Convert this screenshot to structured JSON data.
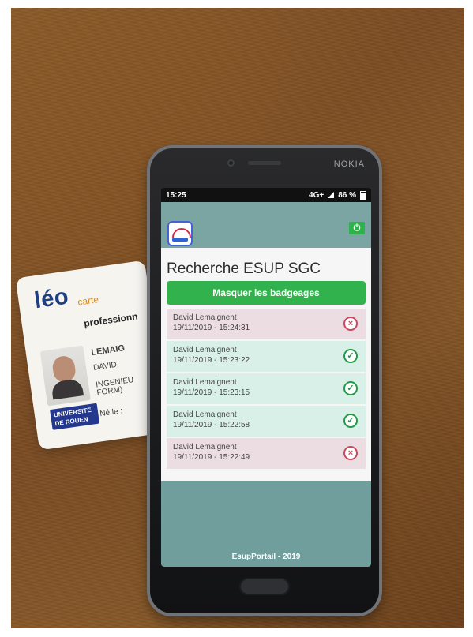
{
  "card": {
    "logo": "léo",
    "subtitle": "carte",
    "heading": "professionn",
    "line1": "LEMAIG",
    "line2": "DAVID",
    "line3": "INGENIEU",
    "line4": "FORM)",
    "line5": "Né le :",
    "univ_line1": "UNIVERSITÉ",
    "univ_line2": "DE ROUEN"
  },
  "phone": {
    "brand": "NOKIA",
    "status": {
      "time": "15:25",
      "network": "4G+",
      "battery": "86 %"
    },
    "app": {
      "title": "Recherche ESUP SGC",
      "hide_button": "Masquer les badgeages",
      "footer": "EsupPortail - 2019"
    },
    "rows": [
      {
        "name": "David Lemaignent",
        "datetime": "19/11/2019 - 15:24:31",
        "status": "fail"
      },
      {
        "name": "David Lemaignent",
        "datetime": "19/11/2019 - 15:23:22",
        "status": "ok"
      },
      {
        "name": "David Lemaignent",
        "datetime": "19/11/2019 - 15:23:15",
        "status": "ok"
      },
      {
        "name": "David Lemaignent",
        "datetime": "19/11/2019 - 15:22:58",
        "status": "ok"
      },
      {
        "name": "David Lemaignent",
        "datetime": "19/11/2019 - 15:22:49",
        "status": "fail"
      }
    ]
  },
  "icons": {
    "power": "power-icon",
    "fail": "cancel-circle-icon",
    "ok": "check-circle-icon",
    "signal": "signal-icon",
    "battery": "battery-icon"
  },
  "colors": {
    "table_bg": "#8a5a2a",
    "success": "#31b24d",
    "ok_row": "#d8f0e7",
    "fail_row": "#ecdde2",
    "fail_icon": "#c8485d",
    "ok_icon": "#229a47",
    "app_header": "#7aa5a3"
  }
}
